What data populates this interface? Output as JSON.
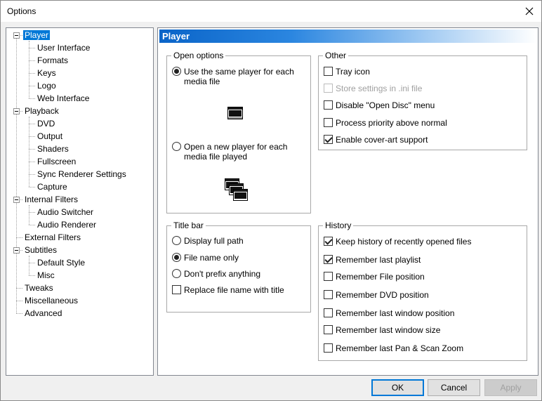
{
  "window": {
    "title": "Options"
  },
  "tree": {
    "items": [
      {
        "label": "Player",
        "level": 0,
        "selected": true,
        "expandable": true
      },
      {
        "label": "User Interface",
        "level": 1
      },
      {
        "label": "Formats",
        "level": 1
      },
      {
        "label": "Keys",
        "level": 1
      },
      {
        "label": "Logo",
        "level": 1
      },
      {
        "label": "Web Interface",
        "level": 1
      },
      {
        "label": "Playback",
        "level": 0,
        "expandable": true
      },
      {
        "label": "DVD",
        "level": 1
      },
      {
        "label": "Output",
        "level": 1
      },
      {
        "label": "Shaders",
        "level": 1
      },
      {
        "label": "Fullscreen",
        "level": 1
      },
      {
        "label": "Sync Renderer Settings",
        "level": 1
      },
      {
        "label": "Capture",
        "level": 1
      },
      {
        "label": "Internal Filters",
        "level": 0,
        "expandable": true
      },
      {
        "label": "Audio Switcher",
        "level": 1
      },
      {
        "label": "Audio Renderer",
        "level": 1
      },
      {
        "label": "External Filters",
        "level": 0
      },
      {
        "label": "Subtitles",
        "level": 0,
        "expandable": true
      },
      {
        "label": "Default Style",
        "level": 1
      },
      {
        "label": "Misc",
        "level": 1
      },
      {
        "label": "Tweaks",
        "level": 0
      },
      {
        "label": "Miscellaneous",
        "level": 0
      },
      {
        "label": "Advanced",
        "level": 0
      }
    ]
  },
  "page": {
    "header": "Player",
    "open_options": {
      "legend": "Open options",
      "same_player": {
        "label": "Use the same player for each media file",
        "checked": true
      },
      "new_player": {
        "label": "Open a new player for each media file played",
        "checked": false
      }
    },
    "other": {
      "legend": "Other",
      "options": [
        {
          "label": "Tray icon",
          "checked": false,
          "disabled": false
        },
        {
          "label": "Store settings in .ini file",
          "checked": false,
          "disabled": true
        },
        {
          "label": "Disable \"Open Disc\" menu",
          "checked": false,
          "disabled": false
        },
        {
          "label": "Process priority above normal",
          "checked": false,
          "disabled": false
        },
        {
          "label": "Enable cover-art support",
          "checked": true,
          "disabled": false
        }
      ]
    },
    "title_bar": {
      "legend": "Title bar",
      "radios": [
        {
          "label": "Display full path",
          "checked": false
        },
        {
          "label": "File name only",
          "checked": true
        },
        {
          "label": "Don't prefix anything",
          "checked": false
        }
      ],
      "replace": {
        "label": "Replace file name with title",
        "checked": false
      }
    },
    "history": {
      "legend": "History",
      "options": [
        {
          "label": "Keep history of recently opened files",
          "checked": true
        },
        {
          "label": "Remember last playlist",
          "checked": true
        },
        {
          "label": "Remember File position",
          "checked": false
        },
        {
          "label": "Remember DVD position",
          "checked": false
        },
        {
          "label": "Remember last window position",
          "checked": false
        },
        {
          "label": "Remember last window size",
          "checked": false
        },
        {
          "label": "Remember last Pan & Scan Zoom",
          "checked": false
        }
      ]
    }
  },
  "buttons": {
    "ok": "OK",
    "cancel": "Cancel",
    "apply": "Apply"
  }
}
